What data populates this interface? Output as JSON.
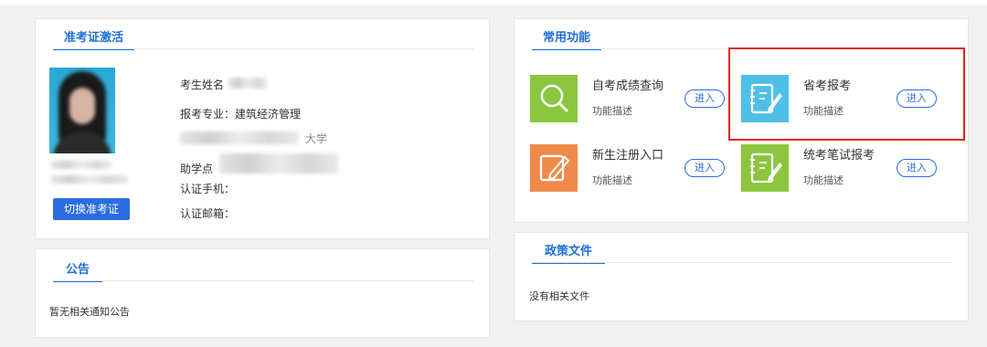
{
  "admission_card": {
    "title": "准考证激活",
    "name_label": "考生姓名",
    "major_label": "报考专业：",
    "major_value": "建筑经济管理",
    "school_partial": "大学",
    "assist_label": "助学点",
    "phone_label": "认证手机：",
    "email_label": "认证邮箱：",
    "switch_button": "切换准考证"
  },
  "notice": {
    "title": "公告",
    "empty_text": "暂无相关通知公告"
  },
  "functions": {
    "title": "常用功能",
    "items": [
      {
        "name": "自考成绩查询",
        "desc": "功能描述",
        "button": "进入",
        "icon": "search-icon",
        "color": "#8cc63f"
      },
      {
        "name": "省考报考",
        "desc": "功能描述",
        "button": "进入",
        "icon": "notebook-pen-icon",
        "color": "#4ec0e8"
      },
      {
        "name": "新生注册入口",
        "desc": "功能描述",
        "button": "进入",
        "icon": "edit-icon",
        "color": "#f08a4b"
      },
      {
        "name": "统考笔试报考",
        "desc": "功能描述",
        "button": "进入",
        "icon": "notebook-pen-icon",
        "color": "#8cc63f"
      }
    ]
  },
  "policy": {
    "title": "政策文件",
    "empty_text": "没有相关文件"
  },
  "colors": {
    "accent": "#1e6fd8",
    "highlight": "#e02020"
  }
}
